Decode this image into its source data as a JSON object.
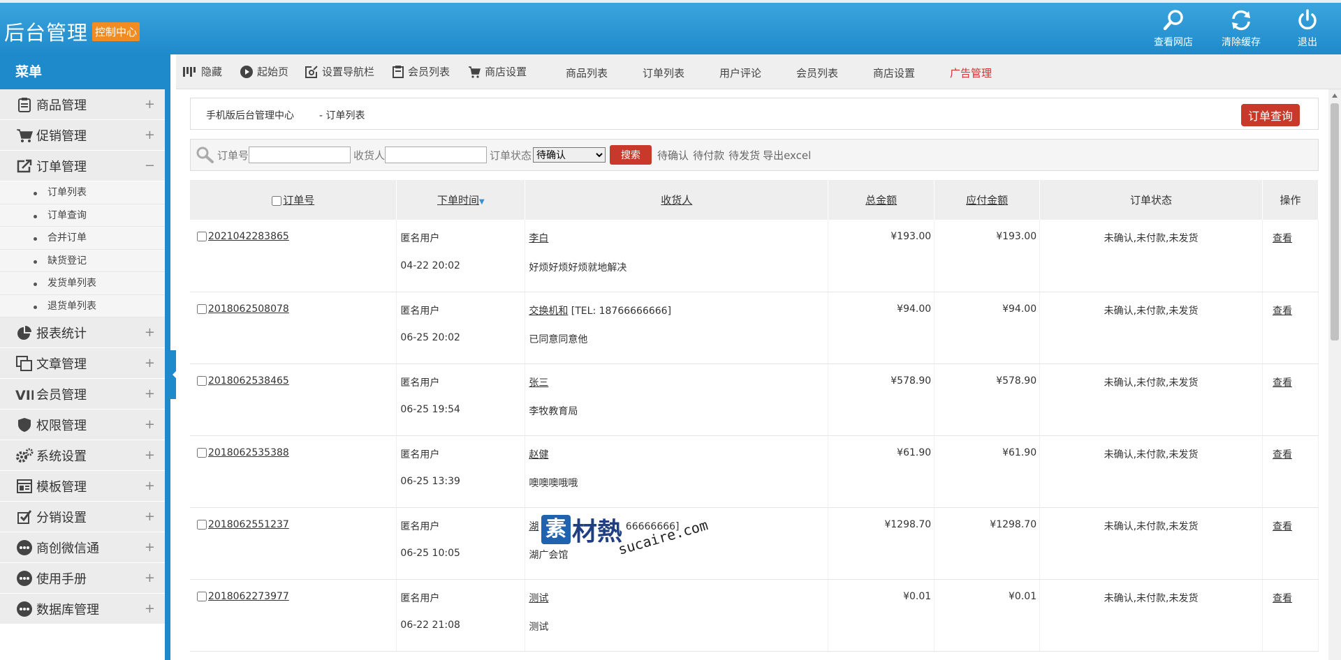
{
  "header": {
    "title": "后台管理",
    "badge": "控制中心",
    "buttons": [
      {
        "label": "查看网店",
        "icon": "search-icon"
      },
      {
        "label": "清除缓存",
        "icon": "refresh-icon"
      },
      {
        "label": "退出",
        "icon": "power-icon"
      }
    ]
  },
  "sidebar": {
    "head": "菜单",
    "items": [
      {
        "label": "商品管理",
        "sign": "+",
        "icon": "clipboard-icon"
      },
      {
        "label": "促销管理",
        "sign": "+",
        "icon": "cart-icon"
      },
      {
        "label": "订单管理",
        "sign": "−",
        "icon": "share-icon"
      },
      {
        "label": "报表统计",
        "sign": "+",
        "icon": "pie-chart-icon"
      },
      {
        "label": "文章管理",
        "sign": "+",
        "icon": "copy-icon"
      },
      {
        "label": "会员管理",
        "sign": "+",
        "icon": "vip-icon"
      },
      {
        "label": "权限管理",
        "sign": "+",
        "icon": "shield-icon"
      },
      {
        "label": "系统设置",
        "sign": "+",
        "icon": "gears-icon"
      },
      {
        "label": "模板管理",
        "sign": "+",
        "icon": "template-icon"
      },
      {
        "label": "分销设置",
        "sign": "+",
        "icon": "checkbox-icon"
      },
      {
        "label": "商创微信通",
        "sign": "+",
        "icon": "chat-icon"
      },
      {
        "label": "使用手册",
        "sign": "+",
        "icon": "chat-icon"
      },
      {
        "label": "数据库管理",
        "sign": "+",
        "icon": "chat-icon"
      }
    ],
    "order_sub": [
      "订单列表",
      "订单查询",
      "合并订单",
      "缺货登记",
      "发货单列表",
      "退货单列表"
    ]
  },
  "toolbar": {
    "hide": "隐藏",
    "home": "起始页",
    "nav_settings": "设置导航栏",
    "member_list": "会员列表",
    "shop_settings": "商店设置",
    "links": [
      "商品列表",
      "订单列表",
      "用户评论",
      "会员列表",
      "商店设置",
      "广告管理"
    ]
  },
  "breadcrumb": {
    "root": "手机版后台管理中心",
    "current": "- 订单列表",
    "query_button": "订单查询"
  },
  "search": {
    "order_no_label": "订单号",
    "consignee_label": "收货人",
    "status_label": "订单状态",
    "status_value": "待确认",
    "search_button": "搜索",
    "quick": [
      "待确认",
      "待付款",
      "待发货",
      "导出excel"
    ]
  },
  "table": {
    "headers": {
      "order_no": "订单号",
      "time": "下单时间",
      "consignee": "收货人",
      "total": "总金额",
      "payable": "应付金额",
      "status": "订单状态",
      "action": "操作"
    },
    "rows": [
      {
        "order_no": "2021042283865",
        "user": "匿名用户",
        "time": "04-22 20:02",
        "consignee": "李白",
        "tel": "",
        "address": "好烦好烦好烦就地解决",
        "total": "¥193.00",
        "payable": "¥193.00",
        "status": "未确认,未付款,未发货",
        "action": "查看"
      },
      {
        "order_no": "2018062508078",
        "user": "匿名用户",
        "time": "06-25 20:02",
        "consignee": "交换机和",
        "tel": "[TEL: 18766666666]",
        "address": "已同意同意他",
        "total": "¥94.00",
        "payable": "¥94.00",
        "status": "未确认,未付款,未发货",
        "action": "查看"
      },
      {
        "order_no": "2018062538465",
        "user": "匿名用户",
        "time": "06-25 19:54",
        "consignee": "张三",
        "tel": "",
        "address": "李牧教育局",
        "total": "¥578.90",
        "payable": "¥578.90",
        "status": "未确认,未付款,未发货",
        "action": "查看"
      },
      {
        "order_no": "2018062535388",
        "user": "匿名用户",
        "time": "06-25 13:39",
        "consignee": "赵健",
        "tel": "",
        "address": "噢噢噢哦哦",
        "total": "¥61.90",
        "payable": "¥61.90",
        "status": "未确认,未付款,未发货",
        "action": "查看"
      },
      {
        "order_no": "2018062551237",
        "user": "匿名用户",
        "time": "06-25 10:05",
        "consignee": "湖",
        "tel": "66666666]",
        "address": "湖广会馆",
        "total": "¥1298.70",
        "payable": "¥1298.70",
        "status": "未确认,未付款,未发货",
        "action": "查看"
      },
      {
        "order_no": "2018062273977",
        "user": "匿名用户",
        "time": "06-22 21:08",
        "consignee": "测试",
        "tel": "",
        "address": "测试",
        "total": "¥0.01",
        "payable": "¥0.01",
        "status": "未确认,未付款,未发货",
        "action": "查看"
      }
    ]
  },
  "watermark": {
    "logo": "素",
    "cn": "材熱",
    "en": "sucaire.com"
  }
}
